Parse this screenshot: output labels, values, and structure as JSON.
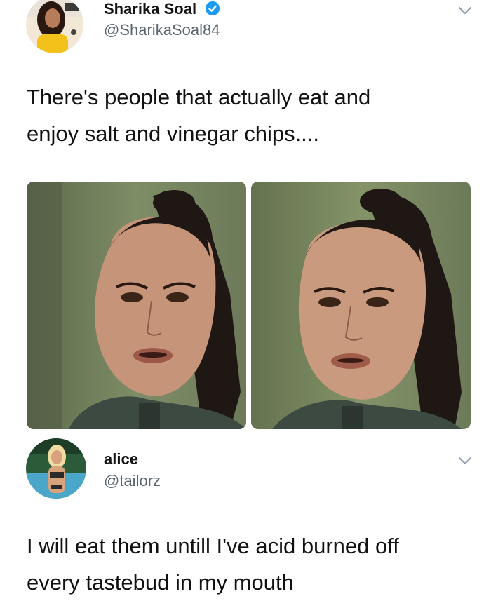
{
  "tweets": [
    {
      "author_name": "Sharika Soal",
      "author_handle": "@SharikaSoal84",
      "verified": true,
      "avatar_icon": "profile-photo-avatar",
      "text_lines": [
        "There's people that actually eat and",
        "enjoy salt and vinegar chips...."
      ],
      "media": [
        {
          "description_icon": "reaction-photo"
        },
        {
          "description_icon": "reaction-photo"
        }
      ]
    },
    {
      "author_name": "alice",
      "author_handle": "@tailorz",
      "verified": false,
      "avatar_icon": "profile-photo-avatar",
      "text_lines": [
        "I will eat them untill I've acid burned off",
        "every tastebud in my mouth"
      ]
    }
  ],
  "colors": {
    "verified_badge": "#1d9bf0",
    "handle": "#5b6670",
    "chevron": "#8b98a5"
  }
}
